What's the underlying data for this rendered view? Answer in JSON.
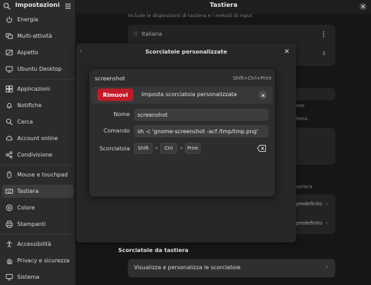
{
  "sidebar": {
    "title": "Impostazioni",
    "items": [
      {
        "label": "Energia",
        "icon": "power-icon"
      },
      {
        "label": "Multi-attività",
        "icon": "multitasking-icon"
      },
      {
        "label": "Aspetto",
        "icon": "appearance-icon"
      },
      {
        "label": "Ubuntu Desktop",
        "icon": "ubuntu-desktop-icon"
      },
      {
        "label": "Applicazioni",
        "icon": "apps-icon"
      },
      {
        "label": "Notifiche",
        "icon": "bell-icon"
      },
      {
        "label": "Cerca",
        "icon": "search-icon"
      },
      {
        "label": "Account online",
        "icon": "cloud-icon"
      },
      {
        "label": "Condivisione",
        "icon": "share-icon"
      },
      {
        "label": "Mouse e touchpad",
        "icon": "mouse-icon"
      },
      {
        "label": "Tastiera",
        "icon": "keyboard-icon"
      },
      {
        "label": "Colore",
        "icon": "color-icon"
      },
      {
        "label": "Stampanti",
        "icon": "printer-icon"
      },
      {
        "label": "Accessibilità",
        "icon": "accessibility-icon"
      },
      {
        "label": "Privacy e sicurezza",
        "icon": "privacy-icon"
      },
      {
        "label": "Sistema",
        "icon": "system-icon"
      }
    ],
    "active_index": 10
  },
  "header": {
    "title": "Tastiera"
  },
  "background": {
    "input_desc": "Include le disposizioni di tastiera e i metodi di input",
    "input_source": "Italiana",
    "row_num": "3",
    "frag_ose": "ose",
    "frag_tiera": "tiera.",
    "frag_tastiera": "tastiera",
    "predef1": "predefinito",
    "predef2": "predefinito",
    "shortcuts_heading": "Scorciatoie da tastiera",
    "shortcuts_row": "Visualizza e personalizza le scorciatoie"
  },
  "outer_dialog": {
    "title": "Scorciatoie personalizzate"
  },
  "list_row": {
    "name": "screenshot",
    "keys": "Shift+Ctrl+Print"
  },
  "edit_dialog": {
    "remove_label": "Rimuovi",
    "title": "Imposta scorciatoia personalizzata",
    "name_label": "Nome",
    "name_value": "screenshot",
    "command_label": "Comando",
    "command_value": "sh -c 'gnome-screenshot -acf /tmp/tmp.png'",
    "shortcut_label": "Scorciatoia",
    "keys": [
      "Shift",
      "Ctrl",
      "Print"
    ],
    "plus": "+"
  },
  "colors": {
    "accent_destructive": "#c01c28",
    "bg": "#1e1e1e",
    "sidebar": "#2b2b2b"
  }
}
